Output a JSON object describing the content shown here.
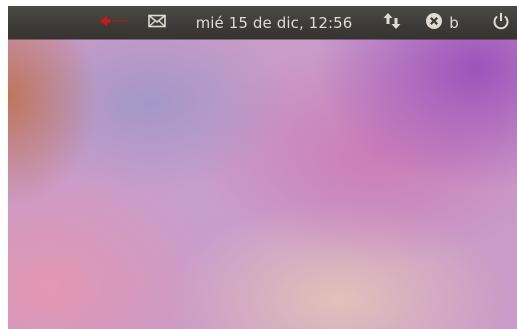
{
  "panel": {
    "clock_text": "mié 15 de dic, 12:56",
    "session_label": "b",
    "icons": {
      "volume": "volume-muted-icon",
      "mail": "envelope-icon",
      "network": "network-updown-icon",
      "session": "session-status-icon",
      "power": "power-icon"
    }
  },
  "colors": {
    "panel_background": "#3c3b37",
    "panel_text": "#dfdbd2",
    "volume_alert": "#d01717"
  }
}
